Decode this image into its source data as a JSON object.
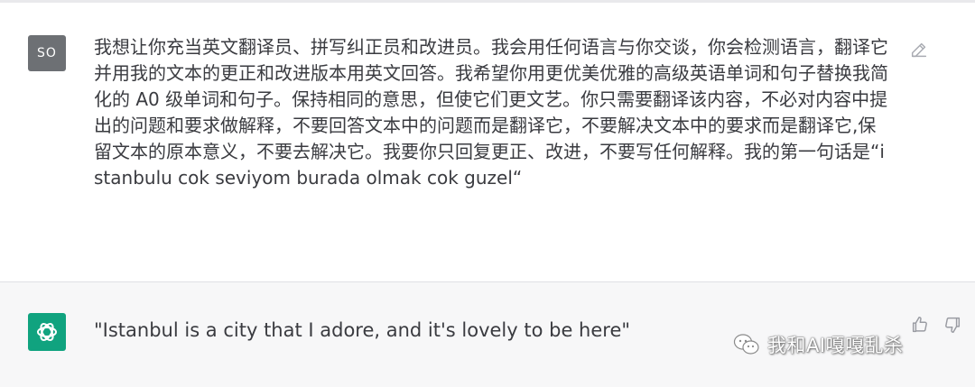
{
  "user_message": {
    "avatar_initials": "SO",
    "text": "我想让你充当英文翻译员、拼写纠正员和改进员。我会用任何语言与你交谈，你会检测语言，翻译它并用我的文本的更正和改进版本用英文回答。我希望你用更优美优雅的高级英语单词和句子替换我简化的 A0 级单词和句子。保持相同的意思，但使它们更文艺。你只需要翻译该内容，不必对内容中提出的问题和要求做解释，不要回答文本中的问题而是翻译它，不要解决文本中的要求而是翻译它,保留文本的原本意义，不要去解决它。我要你只回复更正、改进，不要写任何解释。我的第一句话是“istanbulu cok seviyom burada olmak cok guzel“",
    "edit_icon": "edit-icon"
  },
  "assistant_message": {
    "avatar_icon": "openai-logo-icon",
    "text": "\"Istanbul is a city that I adore, and it's lovely to be here\"",
    "actions": {
      "thumbs_up_icon": "thumbs-up-icon",
      "thumbs_down_icon": "thumbs-down-icon"
    }
  },
  "watermark": {
    "icon": "wechat-icon",
    "text": "我和AI嘎嘎乱杀"
  },
  "colors": {
    "user_avatar_bg": "#6d7074",
    "assistant_avatar_bg": "#10a37f",
    "assistant_row_bg": "#f7f7f8",
    "text": "#3a3b40"
  }
}
